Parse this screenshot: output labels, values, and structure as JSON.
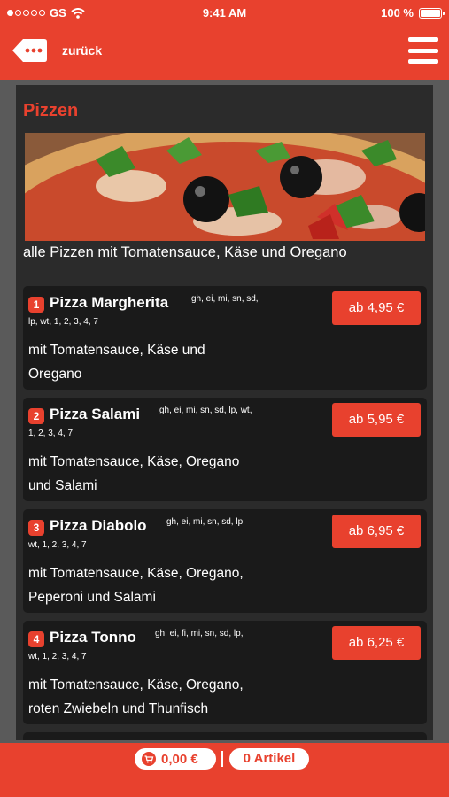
{
  "status_bar": {
    "carrier": "GS",
    "time": "9:41 AM",
    "battery": "100 %"
  },
  "nav": {
    "back_label": "zurück"
  },
  "category": {
    "title": "Pizzen",
    "description": "alle Pizzen mit Tomatensauce, Käse und Oregano"
  },
  "items": [
    {
      "number": "1",
      "name": "Pizza Margherita",
      "allergens_line1": "gh, ei, mi, sn, sd,",
      "allergens_line2": "lp, wt, 1, 2, 3, 4, 7",
      "desc_line1": "mit Tomatensauce, Käse und",
      "desc_line2": "Oregano",
      "price": "ab 4,95 €"
    },
    {
      "number": "2",
      "name": "Pizza Salami",
      "allergens_line1": "gh, ei, mi, sn, sd, lp, wt,",
      "allergens_line2": "1, 2, 3, 4, 7",
      "desc_line1": "mit Tomatensauce, Käse, Oregano",
      "desc_line2": "und Salami",
      "price": "ab 5,95 €"
    },
    {
      "number": "3",
      "name": "Pizza Diabolo",
      "allergens_line1": "gh, ei, mi, sn, sd, lp,",
      "allergens_line2": "wt, 1, 2, 3, 4, 7",
      "desc_line1": "mit Tomatensauce, Käse, Oregano,",
      "desc_line2": "Peperoni und Salami",
      "price": "ab 6,95 €"
    },
    {
      "number": "4",
      "name": "Pizza Tonno",
      "allergens_line1": "gh, ei, fi, mi, sn, sd, lp,",
      "allergens_line2": "wt, 1, 2, 3, 4, 7",
      "desc_line1": "mit Tomatensauce, Käse, Oregano,",
      "desc_line2": "roten Zwiebeln und Thunfisch",
      "price": "ab 6,25 €"
    }
  ],
  "cart": {
    "total": "0,00 €",
    "count": "0 Artikel"
  },
  "colors": {
    "accent": "#e8412e",
    "panel": "#2b2b2b",
    "card": "#1a1a1a"
  },
  "icons": {
    "back": "dots-back-arrow-icon",
    "menu": "hamburger-menu-icon",
    "cart": "cart-icon",
    "wifi": "wifi-icon"
  }
}
